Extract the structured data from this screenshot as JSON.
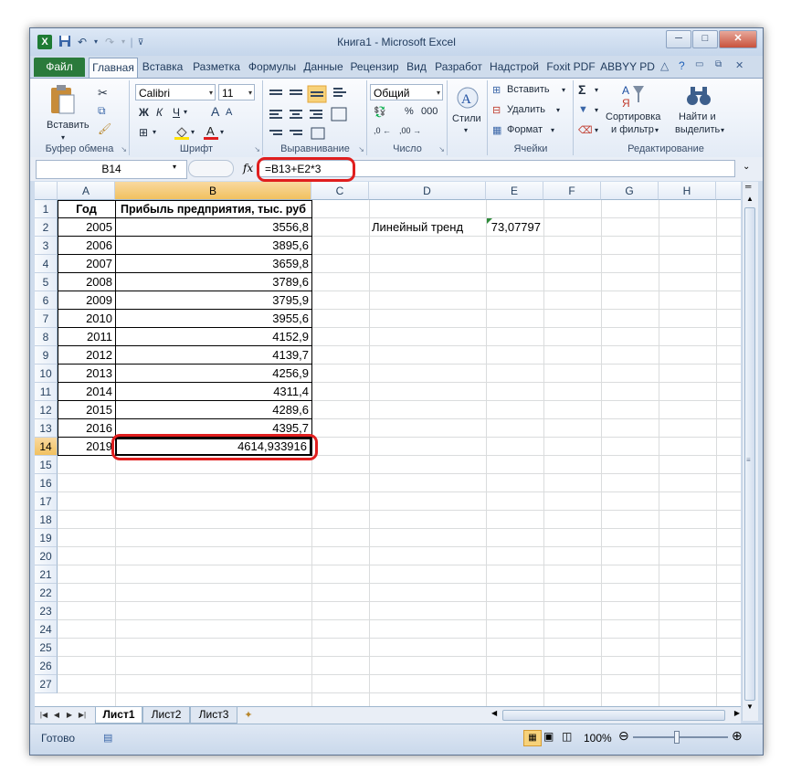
{
  "window": {
    "title": "Книга1 - Microsoft Excel",
    "min": "─",
    "max": "□",
    "close": "✕",
    "app_icon": "X"
  },
  "qat": [
    "save-icon",
    "undo-icon",
    "redo-icon",
    "separator",
    "customize-icon"
  ],
  "tabs": [
    "Файл",
    "Главная",
    "Вставка",
    "Разметка",
    "Формулы",
    "Данные",
    "Рецензир",
    "Вид",
    "Разработ",
    "Надстрой",
    "Foxit PDF",
    "ABBYY PD"
  ],
  "ribbon": {
    "clipboard": {
      "paste": "Вставить",
      "label": "Буфер обмена"
    },
    "font": {
      "name": "Calibri",
      "size": "11",
      "bold": "Ж",
      "italic": "К",
      "underline": "Ч",
      "grow": "A",
      "shrink": "A",
      "label": "Шрифт"
    },
    "alignment": {
      "label": "Выравнивание"
    },
    "number": {
      "format": "Общий",
      "percent": "%",
      "comma": "000",
      "label": "Число"
    },
    "styles": {
      "label": "Стили"
    },
    "cells": {
      "insert": "Вставить",
      "delete": "Удалить",
      "format": "Формат",
      "label": "Ячейки"
    },
    "editing": {
      "sort": "Сортировка",
      "sort2": "и фильтр",
      "find": "Найти и",
      "find2": "выделить",
      "label": "Редактирование"
    }
  },
  "formula_bar": {
    "name_box": "B14",
    "fx": "fx",
    "formula": "=B13+E2*3"
  },
  "columns": [
    "A",
    "B",
    "C",
    "D",
    "E",
    "F",
    "G",
    "H"
  ],
  "rows": [
    "1",
    "2",
    "3",
    "4",
    "5",
    "6",
    "7",
    "8",
    "9",
    "10",
    "11",
    "12",
    "13",
    "14",
    "15",
    "16",
    "17",
    "18",
    "19",
    "20",
    "21",
    "22",
    "23",
    "24",
    "25",
    "26",
    "27"
  ],
  "table": {
    "header_year": "Год",
    "header_profit": "Прибыль предприятия, тыс. руб",
    "data": [
      [
        "2005",
        "3556,8"
      ],
      [
        "2006",
        "3895,6"
      ],
      [
        "2007",
        "3659,8"
      ],
      [
        "2008",
        "3789,6"
      ],
      [
        "2009",
        "3795,9"
      ],
      [
        "2010",
        "3955,6"
      ],
      [
        "2011",
        "4152,9"
      ],
      [
        "2012",
        "4139,7"
      ],
      [
        "2013",
        "4256,9"
      ],
      [
        "2014",
        "4311,4"
      ],
      [
        "2015",
        "4289,6"
      ],
      [
        "2016",
        "4395,7"
      ],
      [
        "2019",
        "4614,933916"
      ]
    ]
  },
  "trend": {
    "label": "Линейный тренд",
    "value": "73,07797"
  },
  "sheets": [
    "Лист1",
    "Лист2",
    "Лист3"
  ],
  "status": {
    "ready": "Готово",
    "zoom": "100%"
  },
  "accent": {
    "file_tab": "#2a7a3b",
    "highlight": "#e01e1e",
    "selected_header": "#f1c15f"
  }
}
